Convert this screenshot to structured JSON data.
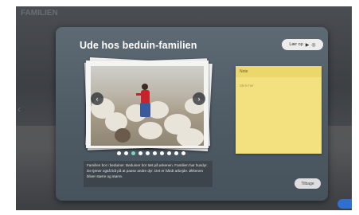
{
  "background": {
    "title": "FAMILIEN"
  },
  "dialog": {
    "title": "Ude hos beduin-familien",
    "listen_label": "Lær op",
    "back_label": "Tilbage"
  },
  "gallery": {
    "dots_total": 10,
    "active_dot": 2,
    "caption": "Familien bor i beduiner. Beduiner bor tæt på ørkenen. Familien har husdyr. De tjener også lidt på at passe andre dyr. Det er hårdt arbejde. Ørkenen bliver større og større."
  },
  "note": {
    "title": "Note",
    "placeholder": "Skriv her"
  },
  "colors": {
    "note": "#f3e07f",
    "active_dot": "#7fd3b8",
    "dialog": "#56636d"
  }
}
